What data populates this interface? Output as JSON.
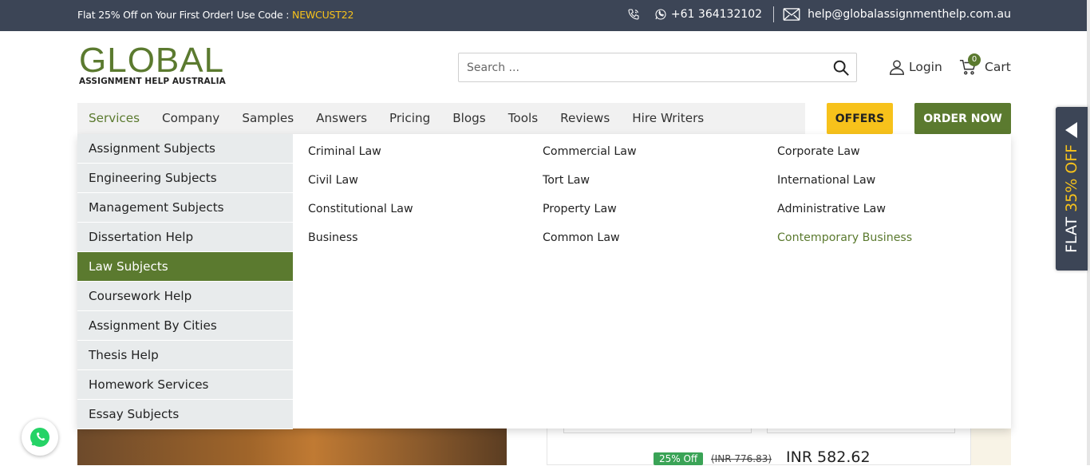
{
  "topbar": {
    "promo_text": "Flat 25% Off on Your First Order! Use Code : ",
    "promo_code": "NEWCUST22",
    "phone": "+61 364132102",
    "email": "help@globalassignmenthelp.com.au"
  },
  "logo": {
    "word": "GLOBAL",
    "tagline": "ASSIGNMENT HELP AUSTRALIA"
  },
  "search": {
    "placeholder": "Search ..."
  },
  "header": {
    "login_label": "Login",
    "cart_label": "Cart",
    "cart_count": "0"
  },
  "nav": {
    "items": [
      "Services",
      "Company",
      "Samples",
      "Answers",
      "Pricing",
      "Blogs",
      "Tools",
      "Reviews",
      "Hire Writers"
    ],
    "active": "Services",
    "offers_label": "OFFERS",
    "order_label": "ORDER NOW"
  },
  "dropdown": {
    "categories": [
      "Assignment Subjects",
      "Engineering Subjects",
      "Management Subjects",
      "Dissertation Help",
      "Law Subjects",
      "Coursework Help",
      "Assignment By Cities",
      "Thesis Help",
      "Homework Services",
      "Essay Subjects"
    ],
    "active_category": "Law Subjects",
    "columns": [
      [
        "Criminal Law",
        "Civil Law",
        "Constitutional Law",
        "Business"
      ],
      [
        "Commercial Law",
        "Tort Law",
        "Property Law",
        "Common Law"
      ],
      [
        "Corporate Law",
        "International Law",
        "Administrative Law",
        "Contemporary Business"
      ]
    ],
    "highlighted_sub": "Contemporary Business"
  },
  "pricing": {
    "discount_badge": "25% Off",
    "old_price": "(INR 776.83)",
    "new_price": "INR 582.62"
  },
  "side_tab": {
    "line1": "FLAT",
    "line2": "35% OFF"
  },
  "colors": {
    "brand_green": "#5b7a2f",
    "topbar_bg": "#3c4556",
    "accent_yellow": "#f7c21b"
  }
}
